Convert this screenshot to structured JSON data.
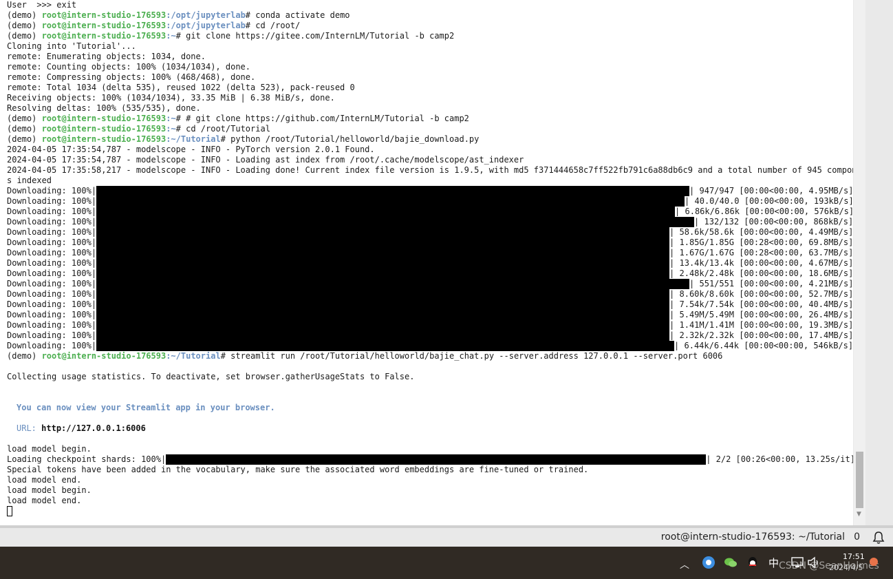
{
  "terminal": {
    "lines": {
      "l0": "User  >>> exit",
      "l11_text": "Cloning into 'Tutorial'...",
      "l5": "remote: Enumerating objects: 1034, done.",
      "l6": "remote: Counting objects: 100% (1034/1034), done.",
      "l7": "remote: Compressing objects: 100% (468/468), done.",
      "l8": "remote: Total 1034 (delta 535), reused 1022 (delta 523), pack-reused 0",
      "l9": "Receiving objects: 100% (1034/1034), 33.35 MiB | 6.38 MiB/s, done.",
      "l10": "Resolving deltas: 100% (535/535), done.",
      "log1": "2024-04-05 17:35:54,787 - modelscope - INFO - PyTorch version 2.0.1 Found.",
      "log2": "2024-04-05 17:35:54,787 - modelscope - INFO - Loading ast index from /root/.cache/modelscope/ast_indexer",
      "log3": "2024-04-05 17:35:58,217 - modelscope - INFO - Loading done! Current index file version is 1.9.5, with md5 f371444658c7ff522fb791c6a88db6c9 and a total number of 945 component",
      "log3b": "s indexed",
      "collect": "Collecting usage statistics. To deactivate, set browser.gatherUsageStats to False.",
      "view": "You can now view your Streamlit app in your browser.",
      "url_label": "URL:",
      "url_value": "http://127.0.0.1:6006",
      "load1": "load model begin.",
      "shards_prefix": "Loading checkpoint shards: 100%|",
      "shards_suffix": "| 2/2 [00:26<00:00, 13.25s/it]",
      "special": "Special tokens have been added in the vocabulary, make sure the associated word embeddings are fine-tuned or trained.",
      "load2": "load model end.",
      "load3": "load model begin.",
      "load4": "load model end."
    },
    "prompts": [
      {
        "env": "(demo) ",
        "user": "root@intern-studio-176593",
        "path": ":/opt/jupyterlab",
        "cmd": "# conda activate demo"
      },
      {
        "env": "(demo) ",
        "user": "root@intern-studio-176593",
        "path": ":/opt/jupyterlab",
        "cmd": "# cd /root/"
      },
      {
        "env": "(demo) ",
        "user": "root@intern-studio-176593",
        "path": ":~",
        "cmd": "# git clone https://gitee.com/InternLM/Tutorial -b camp2"
      },
      {
        "env": "(demo) ",
        "user": "root@intern-studio-176593",
        "path": ":~",
        "cmd": "# # git clone https://github.com/InternLM/Tutorial -b camp2"
      },
      {
        "env": "(demo) ",
        "user": "root@intern-studio-176593",
        "path": ":~",
        "cmd": "# cd /root/Tutorial"
      },
      {
        "env": "(demo) ",
        "user": "root@intern-studio-176593",
        "path": ":~/Tutorial",
        "cmd": "# python /root/Tutorial/helloworld/bajie_download.py"
      },
      {
        "env": "(demo) ",
        "user": "root@intern-studio-176593",
        "path": ":~/Tutorial",
        "cmd": "# streamlit run /root/Tutorial/helloworld/bajie_chat.py --server.address 127.0.0.1 --server.port 6006"
      }
    ],
    "downloads": [
      {
        "prefix": "Downloading: 100%|",
        "suffix": "| 947/947 [00:00<00:00, 4.95MB/s]",
        "fill": 1.0
      },
      {
        "prefix": "Downloading: 100%|",
        "suffix": "| 40.0/40.0 [00:00<00:00, 193kB/s]",
        "fill": 1.0
      },
      {
        "prefix": "Downloading: 100%|",
        "suffix": "| 6.86k/6.86k [00:00<00:00, 576kB/s]",
        "fill": 1.0
      },
      {
        "prefix": "Downloading: 100%|",
        "suffix": "| 132/132 [00:00<00:00, 868kB/s]",
        "fill": 1.0
      },
      {
        "prefix": "Downloading: 100%|",
        "suffix": "| 58.6k/58.6k [00:00<00:00, 4.49MB/s]",
        "fill": 1.0
      },
      {
        "prefix": "Downloading: 100%|",
        "suffix": "| 1.85G/1.85G [00:28<00:00, 69.8MB/s]",
        "fill": 1.0
      },
      {
        "prefix": "Downloading: 100%|",
        "suffix": "| 1.67G/1.67G [00:28<00:00, 63.7MB/s]",
        "fill": 1.0
      },
      {
        "prefix": "Downloading: 100%|",
        "suffix": "| 13.4k/13.4k [00:00<00:00, 4.67MB/s]",
        "fill": 1.0
      },
      {
        "prefix": "Downloading: 100%|",
        "suffix": "| 2.48k/2.48k [00:00<00:00, 18.6MB/s]",
        "fill": 1.0
      },
      {
        "prefix": "Downloading: 100%|",
        "suffix": "| 551/551 [00:00<00:00, 4.21MB/s]",
        "fill": 1.0
      },
      {
        "prefix": "Downloading: 100%|",
        "suffix": "| 8.60k/8.60k [00:00<00:00, 52.7MB/s]",
        "fill": 1.0
      },
      {
        "prefix": "Downloading: 100%|",
        "suffix": "| 7.54k/7.54k [00:00<00:00, 40.4MB/s]",
        "fill": 1.0
      },
      {
        "prefix": "Downloading: 100%|",
        "suffix": "| 5.49M/5.49M [00:00<00:00, 26.4MB/s]",
        "fill": 1.0
      },
      {
        "prefix": "Downloading: 100%|",
        "suffix": "| 1.41M/1.41M [00:00<00:00, 19.3MB/s]",
        "fill": 1.0
      },
      {
        "prefix": "Downloading: 100%|",
        "suffix": "| 2.32k/2.32k [00:00<00:00, 17.4MB/s]",
        "fill": 1.0
      },
      {
        "prefix": "Downloading: 100%|",
        "suffix": "| 6.44k/6.44k [00:00<00:00, 546kB/s]",
        "fill": 1.0
      }
    ]
  },
  "statusbar": {
    "title": "root@intern-studio-176593: ~/Tutorial",
    "count": "0",
    "icon": "bell-icon"
  },
  "taskbar": {
    "ime": "中",
    "time": "17:51",
    "date": "2024/4/5",
    "watermark": "CSDN @SeanHolmes",
    "icons": [
      "chevron-up-icon",
      "browser-icon",
      "wechat-icon",
      "qq-icon",
      "screen-icon",
      "volume-icon",
      "notification-icon"
    ]
  },
  "colors": {
    "user": "#4caf50",
    "path": "#6a8fbf",
    "terminal_bg": "#ffffff",
    "taskbar_bg": "#302a24"
  }
}
